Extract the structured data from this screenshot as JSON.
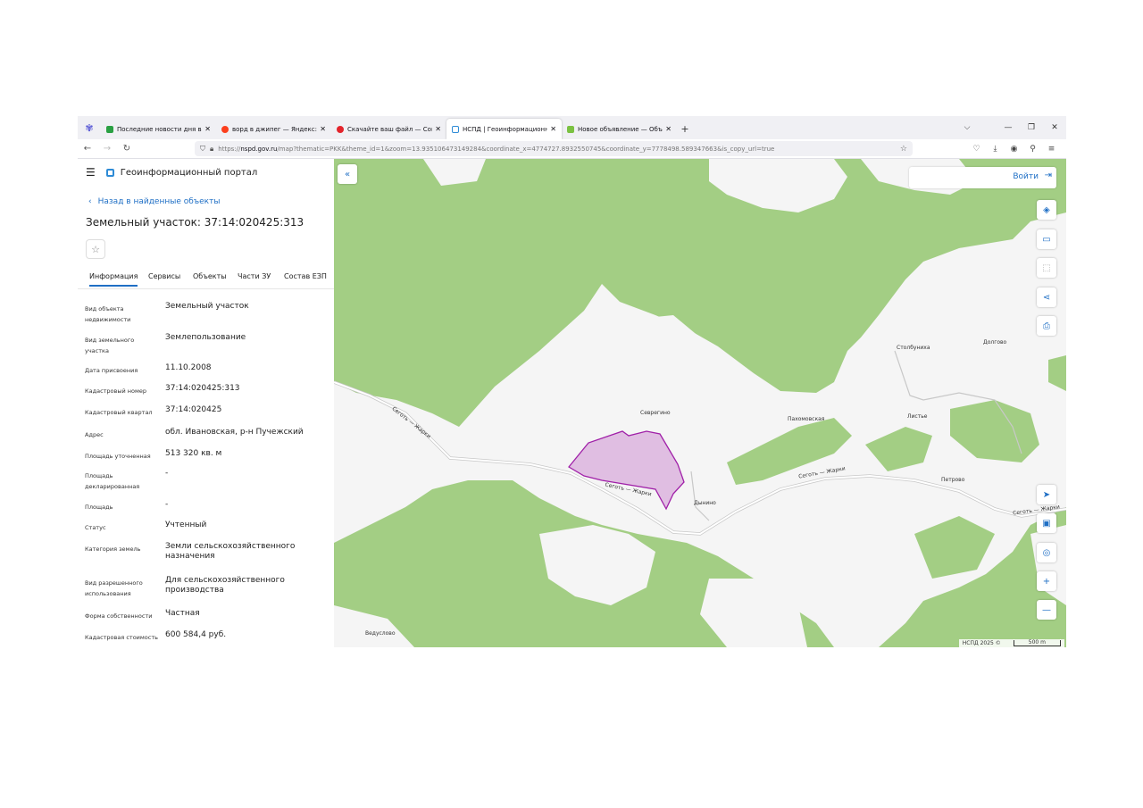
{
  "browser": {
    "tabs": [
      {
        "title": "Последние новости дня в Росс",
        "favicon_color": "#2aa043",
        "active": false
      },
      {
        "title": "ворд в джипег — Яндекс: наш",
        "favicon_color": "#fc3f1d",
        "active": false
      },
      {
        "title": "Скачайте ваш файл — Convert",
        "favicon_color": "#e3242b",
        "active": false
      },
      {
        "title": "НСПД | Геоинформационный",
        "favicon_color": "#2e8bd6",
        "active": true
      },
      {
        "title": "Новое объявление — Объявле",
        "favicon_color": "#7bc142",
        "active": false
      }
    ],
    "url_prefix": "https://",
    "url_host": "nspd.gov.ru",
    "url_rest": "/map?thematic=PKK&theme_id=1&zoom=13.935106473149284&coordinate_x=4774727.8932550745&coordinate_y=7778498.589347663&is_copy_url=true"
  },
  "panel": {
    "portal_title": "Геоинформационный портал",
    "back_label": "Назад в найденные объекты",
    "title": "Земельный участок: 37:14:020425:313",
    "tabs": [
      "Информация",
      "Сервисы",
      "Объекты",
      "Части ЗУ",
      "Состав ЕЗП"
    ],
    "rows": [
      {
        "key": "Вид объекта недвижимости",
        "value": "Земельный участок"
      },
      {
        "key": "Вид земельного участка",
        "value": "Землепользование"
      },
      {
        "key": "Дата присвоения",
        "value": "11.10.2008"
      },
      {
        "key": "Кадастровый номер",
        "value": "37:14:020425:313"
      },
      {
        "key": "Кадастровый квартал",
        "value": "37:14:020425"
      },
      {
        "key": "Адрес",
        "value": "обл. Ивановская, р-н Пучежский"
      },
      {
        "key": "Площадь уточненная",
        "value": "513 320 кв. м"
      },
      {
        "key": "Площадь декларированная",
        "value": "-"
      },
      {
        "key": "Площадь",
        "value": "-"
      },
      {
        "key": "Статус",
        "value": "Учтенный"
      },
      {
        "key": "Категория земель",
        "value": "Земли сельскохозяйственного назначения"
      },
      {
        "key": "Вид разрешенного использования",
        "value": "Для сельскохозяйственного производства"
      },
      {
        "key": "Форма собственности",
        "value": "Частная"
      },
      {
        "key": "Кадастровая стоимость",
        "value": "600 584,4 руб."
      }
    ]
  },
  "map": {
    "login_label": "Войти",
    "places": [
      "Столбуниха",
      "Долгово",
      "Севрегино",
      "Пахомовская",
      "Листье",
      "Петрово",
      "Дынино",
      "Ведуслово"
    ],
    "roads": [
      "Сеготь — Жарки",
      "Сеготь — Жарки",
      "Сеготь — Жарки",
      "Сеготь — Жарки"
    ],
    "attribution": "НСПД 2025 ©",
    "scale_label": "500 m",
    "colors": {
      "forest": "#a3ce84",
      "field": "#f4f4f4",
      "parcel_fill": "#dcb4de",
      "parcel_stroke": "#a020a8",
      "accent": "#1f6fc5"
    }
  }
}
